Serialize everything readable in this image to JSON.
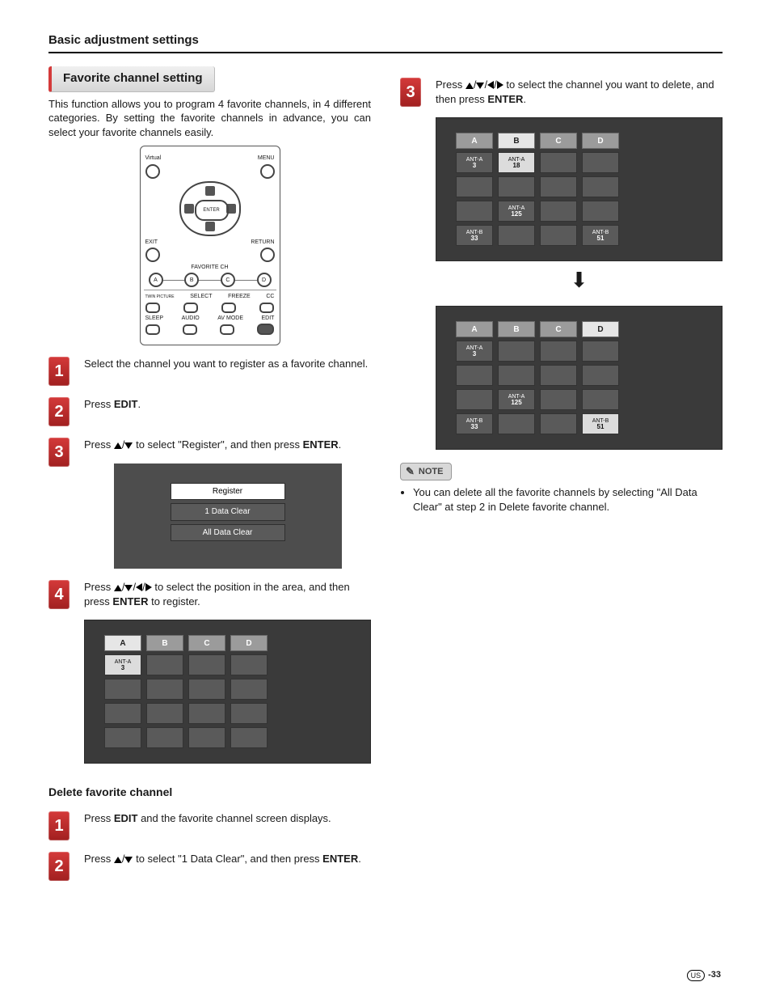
{
  "header": {
    "title": "Basic adjustment settings"
  },
  "section": {
    "title": "Favorite channel setting",
    "intro": "This function allows you to program 4 favorite channels, in 4 different categories. By setting the favorite channels in advance, you can select your favorite channels easily."
  },
  "remote": {
    "top_left": "Virtual",
    "top_right": "MENU",
    "exit": "EXIT",
    "return": "RETURN",
    "enter": "ENTER",
    "fav_label": "FAVORITE CH",
    "fav_a": "A",
    "fav_b": "B",
    "fav_c": "C",
    "fav_d": "D",
    "row3_1": "TWIN PICTURE",
    "row3_2": "SELECT",
    "row3_3": "FREEZE",
    "row3_4": "CC",
    "row4_1": "SLEEP",
    "row4_2": "AUDIO",
    "row4_3": "AV MODE",
    "row4_4": "EDIT"
  },
  "steps_left": {
    "s1": "Select the channel you want to register as a favorite channel.",
    "s2_pre": "Press ",
    "s2_b": "EDIT",
    "s2_post": ".",
    "s3_pre": "Press ",
    "s3_mid": " to select \"Register\", and then press ",
    "s3_b": "ENTER",
    "s3_post": ".",
    "s4_pre": "Press ",
    "s4_mid": " to select the position in the area, and then press ",
    "s4_b": "ENTER",
    "s4_post": " to register."
  },
  "menu": {
    "r1": "Register",
    "r2": "1 Data Clear",
    "r3": "All Data Clear"
  },
  "grid_headers": {
    "a": "A",
    "b": "B",
    "c": "C",
    "d": "D"
  },
  "grid4": {
    "c_a1_l": "ANT-A",
    "c_a1_v": "3"
  },
  "delete": {
    "heading": "Delete favorite channel",
    "s1_pre": "Press ",
    "s1_b": "EDIT",
    "s1_post": " and the favorite channel screen displays.",
    "s2_pre": "Press ",
    "s2_mid": " to select \"1 Data Clear\", and then press ",
    "s2_b": "ENTER",
    "s2_post": "."
  },
  "right": {
    "s3_pre": "Press ",
    "s3_mid": " to select the channel you want to delete, and then press ",
    "s3_b": "ENTER",
    "s3_post": "."
  },
  "grid_r1": {
    "a1_l": "ANT-A",
    "a1_v": "3",
    "b1_l": "ANT-A",
    "b1_v": "18",
    "b3_l": "ANT-A",
    "b3_v": "125",
    "a4_l": "ANT-B",
    "a4_v": "33",
    "d4_l": "ANT-B",
    "d4_v": "51"
  },
  "grid_r2": {
    "a1_l": "ANT-A",
    "a1_v": "3",
    "b3_l": "ANT-A",
    "b3_v": "125",
    "a4_l": "ANT-B",
    "a4_v": "33",
    "d4_l": "ANT-B",
    "d4_v": "51"
  },
  "note": {
    "label": "NOTE",
    "text": "You can delete all the favorite channels by selecting \"All Data Clear\" at step 2 in Delete favorite channel."
  },
  "footer": {
    "region": "US",
    "page": "-33"
  }
}
